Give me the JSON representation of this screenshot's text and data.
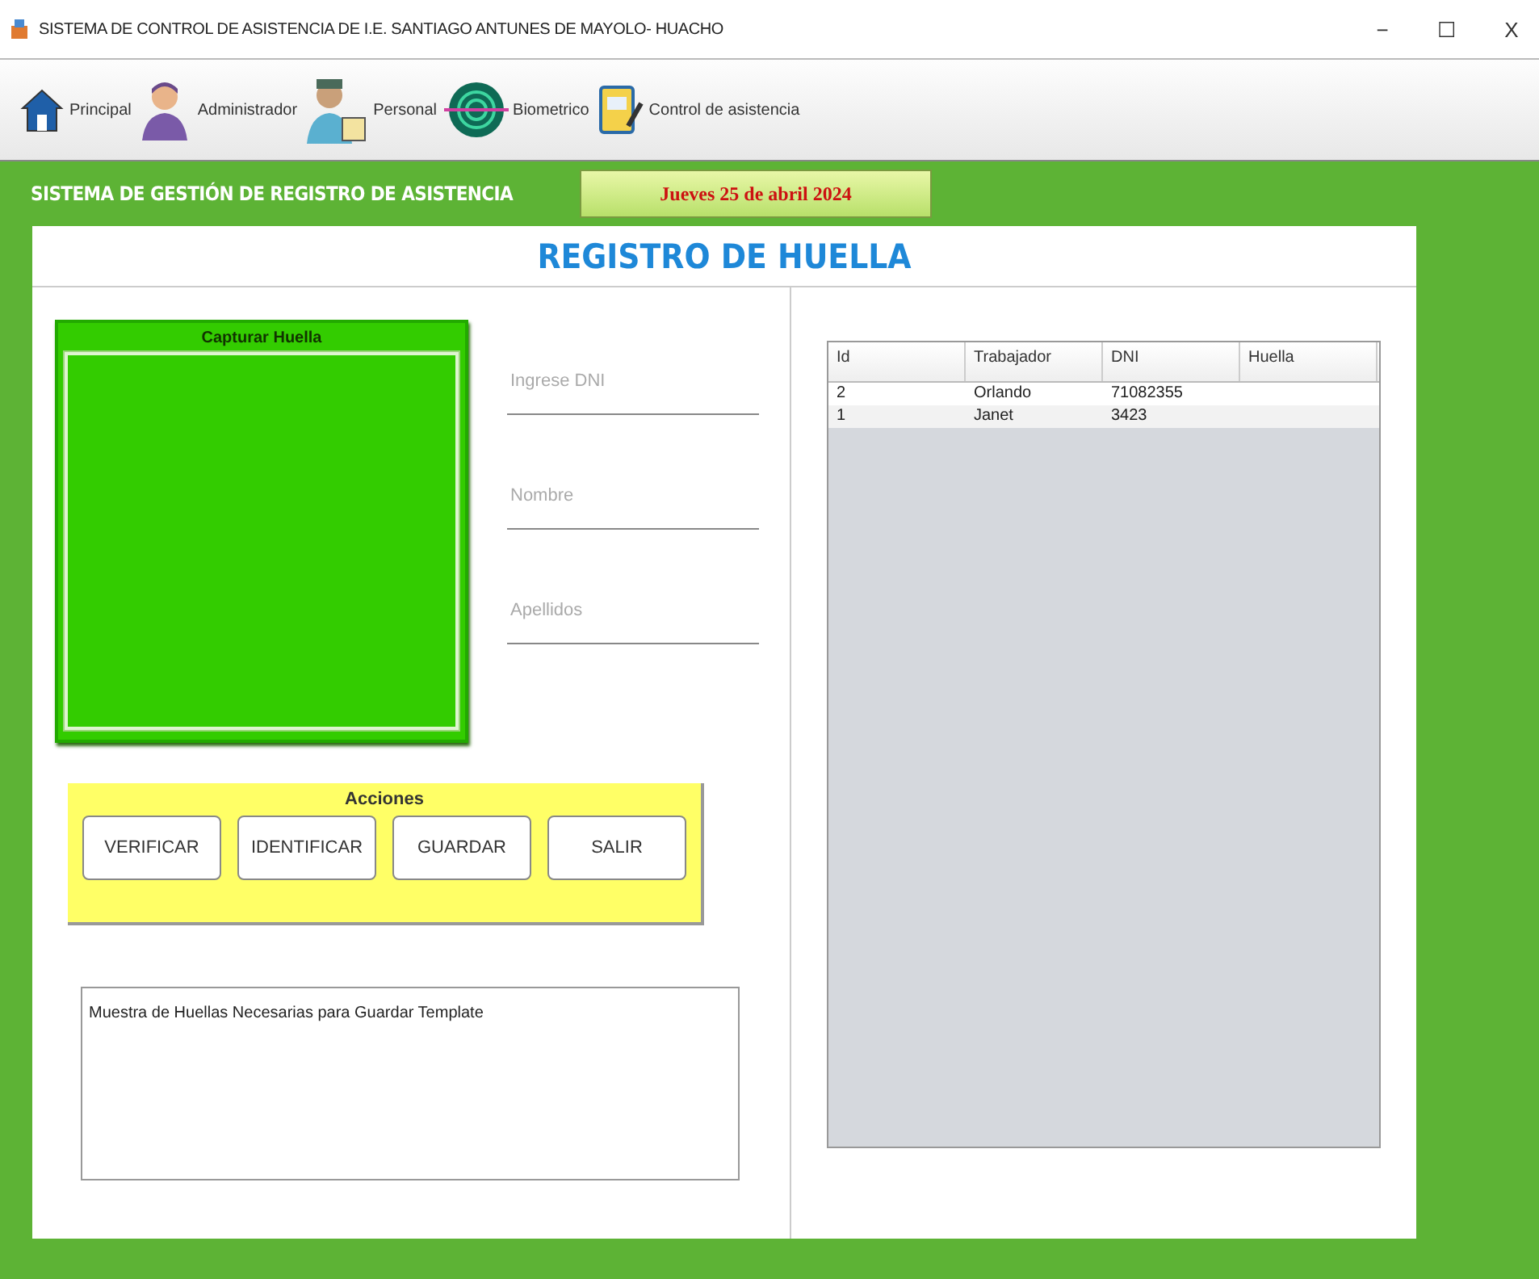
{
  "window": {
    "title": "SISTEMA DE CONTROL DE ASISTENCIA DE I.E. SANTIAGO ANTUNES DE MAYOLO- HUACHO",
    "controls": [
      "−",
      "☐",
      "X"
    ]
  },
  "toolbar": [
    {
      "kind": "home",
      "label": "Principal"
    },
    {
      "kind": "admin",
      "label": "Administrador"
    },
    {
      "kind": "staff",
      "label": "Personal"
    },
    {
      "kind": "biometric",
      "label": "Biometrico"
    },
    {
      "kind": "attendance",
      "label": "Control de asistencia"
    }
  ],
  "header": {
    "title": "SISTEMA DE GESTIÓN DE REGISTRO DE ASISTENCIA",
    "date": "Jueves 25 de abril 2024"
  },
  "panel_title": "REGISTRO DE HUELLA",
  "capture": {
    "title": "Capturar Huella"
  },
  "fields": [
    {
      "placeholder": "Ingrese DNI"
    },
    {
      "placeholder": "Nombre"
    },
    {
      "placeholder": "Apellidos"
    }
  ],
  "actions": {
    "title": "Acciones",
    "buttons": [
      "VERIFICAR",
      "IDENTIFICAR",
      "GUARDAR",
      "SALIR"
    ]
  },
  "message": "Muestra de Huellas Necesarias para Guardar Template",
  "table": {
    "columns": [
      "Id",
      "Trabajador",
      "DNI",
      "Huella"
    ],
    "rows": [
      [
        "2",
        "Orlando",
        "71082355"
      ],
      [
        "1",
        "Janet",
        "3423"
      ]
    ]
  }
}
